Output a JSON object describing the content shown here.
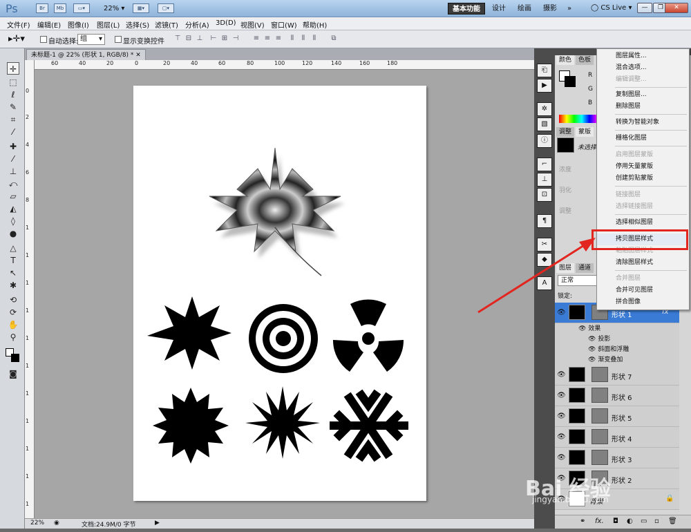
{
  "titlebar": {
    "logo": "Ps",
    "br": "Br",
    "mb": "Mb",
    "zoom": "22%",
    "workspaces": [
      "基本功能",
      "设计",
      "绘画",
      "摄影",
      "»"
    ],
    "cslive": "CS Live",
    "win_buttons": [
      "—",
      "❐",
      "✕"
    ]
  },
  "menubar": [
    "文件(F)",
    "编辑(E)",
    "图像(I)",
    "图层(L)",
    "选择(S)",
    "滤镜(T)",
    "分析(A)",
    "3D(D)",
    "视图(V)",
    "窗口(W)",
    "帮助(H)"
  ],
  "options": {
    "auto_select_label": "自动选择:",
    "auto_select_value": "组",
    "show_transform_label": "显示变换控件"
  },
  "document": {
    "tab_title": "未标题-1 @ 22% (形状 1, RGB/8) *",
    "close": "✕",
    "ruler_top": [
      "60",
      "40",
      "20",
      "0",
      "20",
      "40",
      "60",
      "80",
      "100",
      "120",
      "140",
      "160",
      "180"
    ],
    "ruler_left": [
      "0",
      "2",
      "4",
      "6",
      "8",
      "1",
      "1",
      "1",
      "1",
      "1",
      "1",
      "1",
      "1",
      "1",
      "1",
      "1",
      "2",
      "2"
    ]
  },
  "statusbar": {
    "zoom": "22%",
    "doc_info": "文档:24.9M/0 字节"
  },
  "colors": {
    "accent_red": "#e3251f",
    "workspace_active": "#3b3b3b",
    "layer_selected": "#3a7bd5"
  },
  "panels": {
    "tabs_top": [
      "颜色",
      "色板"
    ],
    "rgb_labels": [
      "R",
      "G",
      "B"
    ],
    "tabs_adjust": [
      "调整",
      "蒙版"
    ],
    "mask_label": "未选择",
    "adjust_labels": [
      "浓度",
      "羽化",
      "调整"
    ],
    "tabs_layers": [
      "图层",
      "通道"
    ],
    "blend_mode": "正常",
    "lock_label": "锁定:",
    "layers": [
      {
        "name": "形状 1",
        "selected": true
      },
      {
        "name": "形状 7"
      },
      {
        "name": "形状 6"
      },
      {
        "name": "形状 5"
      },
      {
        "name": "形状 4"
      },
      {
        "name": "形状 3"
      },
      {
        "name": "形状 2"
      },
      {
        "name": "背景"
      }
    ],
    "effects_label": "效果",
    "effects": [
      "投影",
      "斜面和浮雕",
      "渐变叠加"
    ],
    "fx_mark": "fx"
  },
  "context_menu": [
    {
      "label": "图层属性...",
      "enabled": true
    },
    {
      "label": "混合选项...",
      "enabled": true
    },
    {
      "label": "编辑调整...",
      "enabled": false
    },
    {
      "label": "复制图层...",
      "enabled": true
    },
    {
      "label": "删除图层",
      "enabled": true
    },
    {
      "label": "转换为智能对象",
      "enabled": true
    },
    {
      "label": "栅格化图层",
      "enabled": true
    },
    {
      "label": "启用图层蒙版",
      "enabled": false
    },
    {
      "label": "停用矢量蒙版",
      "enabled": true
    },
    {
      "label": "创建剪贴蒙版",
      "enabled": true
    },
    {
      "label": "链接图层",
      "enabled": false
    },
    {
      "label": "选择链接图层",
      "enabled": false
    },
    {
      "label": "选择相似图层",
      "enabled": true
    },
    {
      "label": "拷贝图层样式",
      "enabled": true
    },
    {
      "label": "粘贴图层样式",
      "enabled": false
    },
    {
      "label": "清除图层样式",
      "enabled": true
    },
    {
      "label": "合并图层",
      "enabled": false
    },
    {
      "label": "合并可见图层",
      "enabled": true
    },
    {
      "label": "拼合图像",
      "enabled": true
    }
  ],
  "watermark": {
    "brand": "Bai 经验",
    "url": "jingyan.baidu.com"
  }
}
